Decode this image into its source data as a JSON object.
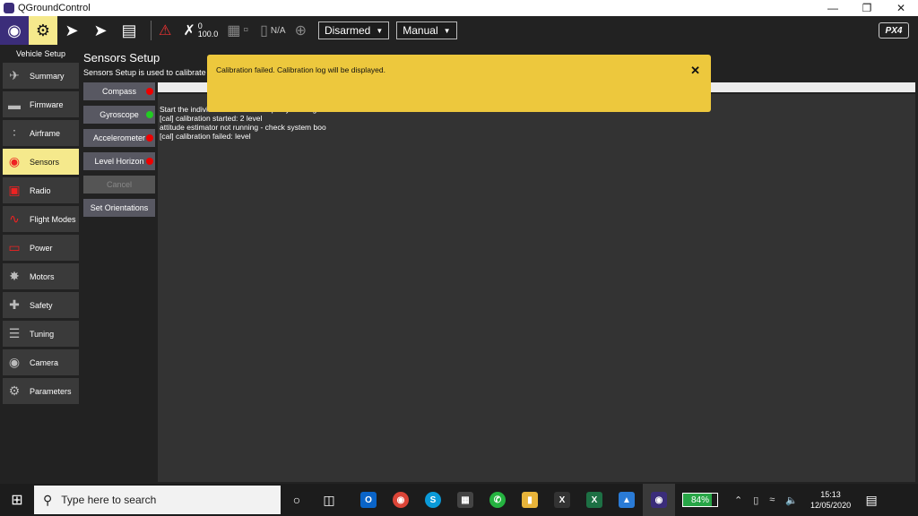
{
  "window": {
    "title": "QGroundControl",
    "min_icon": "minimize-icon",
    "restore_icon": "restore-icon",
    "close_icon": "close-icon"
  },
  "toolbar": {
    "gps_count": "0",
    "gps_hdop": "100.0",
    "battery_label": "N/A",
    "arm_state": "Disarmed",
    "flight_mode": "Manual",
    "brand": "PX4"
  },
  "sidebar": {
    "header": "Vehicle Setup",
    "items": [
      {
        "label": "Summary",
        "icon": "plane-icon"
      },
      {
        "label": "Firmware",
        "icon": "firmware-icon"
      },
      {
        "label": "Airframe",
        "icon": "airframe-icon"
      },
      {
        "label": "Sensors",
        "icon": "sensors-icon"
      },
      {
        "label": "Radio",
        "icon": "radio-icon"
      },
      {
        "label": "Flight Modes",
        "icon": "flight-modes-icon"
      },
      {
        "label": "Power",
        "icon": "power-icon"
      },
      {
        "label": "Motors",
        "icon": "motors-icon"
      },
      {
        "label": "Safety",
        "icon": "safety-icon"
      },
      {
        "label": "Tuning",
        "icon": "tuning-icon"
      },
      {
        "label": "Camera",
        "icon": "camera-icon"
      },
      {
        "label": "Parameters",
        "icon": "parameters-icon"
      }
    ]
  },
  "main": {
    "title": "Sensors Setup",
    "description": "Sensors Setup is used to calibrate th",
    "buttons": [
      {
        "label": "Compass",
        "status": "red"
      },
      {
        "label": "Gyroscope",
        "status": "green"
      },
      {
        "label": "Accelerometer",
        "status": "red"
      },
      {
        "label": "Level Horizon",
        "status": "red"
      },
      {
        "label": "Cancel",
        "status": ""
      },
      {
        "label": "Set Orientations",
        "status": ""
      }
    ],
    "log": [
      "Start the individual calibration steps by clicking one of the buttons to the left.",
      "[cal] calibration started: 2 level",
      "attitude estimator not running - check system boo",
      "[cal] calibration failed: level"
    ]
  },
  "notification": {
    "message": "Calibration failed. Calibration log will be displayed.",
    "close": "✕"
  },
  "taskbar": {
    "search_placeholder": "Type here to search",
    "battery": "84%",
    "time": "15:13",
    "date": "12/05/2020"
  },
  "colors": {
    "accent_yellow": "#f5e98c",
    "notify": "#edc83d",
    "status_red": "#e00000",
    "status_green": "#22cc22"
  }
}
